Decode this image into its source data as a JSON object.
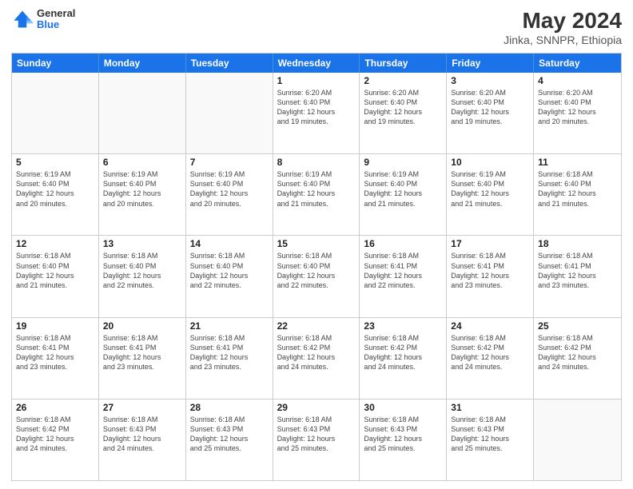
{
  "header": {
    "logo": {
      "line1": "General",
      "line2": "Blue"
    },
    "title": "May 2024",
    "location": "Jinka, SNNPR, Ethiopia"
  },
  "weekdays": [
    "Sunday",
    "Monday",
    "Tuesday",
    "Wednesday",
    "Thursday",
    "Friday",
    "Saturday"
  ],
  "rows": [
    [
      {
        "day": "",
        "info": "",
        "empty": true
      },
      {
        "day": "",
        "info": "",
        "empty": true
      },
      {
        "day": "",
        "info": "",
        "empty": true
      },
      {
        "day": "1",
        "info": "Sunrise: 6:20 AM\nSunset: 6:40 PM\nDaylight: 12 hours\nand 19 minutes.",
        "empty": false
      },
      {
        "day": "2",
        "info": "Sunrise: 6:20 AM\nSunset: 6:40 PM\nDaylight: 12 hours\nand 19 minutes.",
        "empty": false
      },
      {
        "day": "3",
        "info": "Sunrise: 6:20 AM\nSunset: 6:40 PM\nDaylight: 12 hours\nand 19 minutes.",
        "empty": false
      },
      {
        "day": "4",
        "info": "Sunrise: 6:20 AM\nSunset: 6:40 PM\nDaylight: 12 hours\nand 20 minutes.",
        "empty": false
      }
    ],
    [
      {
        "day": "5",
        "info": "Sunrise: 6:19 AM\nSunset: 6:40 PM\nDaylight: 12 hours\nand 20 minutes.",
        "empty": false
      },
      {
        "day": "6",
        "info": "Sunrise: 6:19 AM\nSunset: 6:40 PM\nDaylight: 12 hours\nand 20 minutes.",
        "empty": false
      },
      {
        "day": "7",
        "info": "Sunrise: 6:19 AM\nSunset: 6:40 PM\nDaylight: 12 hours\nand 20 minutes.",
        "empty": false
      },
      {
        "day": "8",
        "info": "Sunrise: 6:19 AM\nSunset: 6:40 PM\nDaylight: 12 hours\nand 21 minutes.",
        "empty": false
      },
      {
        "day": "9",
        "info": "Sunrise: 6:19 AM\nSunset: 6:40 PM\nDaylight: 12 hours\nand 21 minutes.",
        "empty": false
      },
      {
        "day": "10",
        "info": "Sunrise: 6:19 AM\nSunset: 6:40 PM\nDaylight: 12 hours\nand 21 minutes.",
        "empty": false
      },
      {
        "day": "11",
        "info": "Sunrise: 6:18 AM\nSunset: 6:40 PM\nDaylight: 12 hours\nand 21 minutes.",
        "empty": false
      }
    ],
    [
      {
        "day": "12",
        "info": "Sunrise: 6:18 AM\nSunset: 6:40 PM\nDaylight: 12 hours\nand 21 minutes.",
        "empty": false
      },
      {
        "day": "13",
        "info": "Sunrise: 6:18 AM\nSunset: 6:40 PM\nDaylight: 12 hours\nand 22 minutes.",
        "empty": false
      },
      {
        "day": "14",
        "info": "Sunrise: 6:18 AM\nSunset: 6:40 PM\nDaylight: 12 hours\nand 22 minutes.",
        "empty": false
      },
      {
        "day": "15",
        "info": "Sunrise: 6:18 AM\nSunset: 6:40 PM\nDaylight: 12 hours\nand 22 minutes.",
        "empty": false
      },
      {
        "day": "16",
        "info": "Sunrise: 6:18 AM\nSunset: 6:41 PM\nDaylight: 12 hours\nand 22 minutes.",
        "empty": false
      },
      {
        "day": "17",
        "info": "Sunrise: 6:18 AM\nSunset: 6:41 PM\nDaylight: 12 hours\nand 23 minutes.",
        "empty": false
      },
      {
        "day": "18",
        "info": "Sunrise: 6:18 AM\nSunset: 6:41 PM\nDaylight: 12 hours\nand 23 minutes.",
        "empty": false
      }
    ],
    [
      {
        "day": "19",
        "info": "Sunrise: 6:18 AM\nSunset: 6:41 PM\nDaylight: 12 hours\nand 23 minutes.",
        "empty": false
      },
      {
        "day": "20",
        "info": "Sunrise: 6:18 AM\nSunset: 6:41 PM\nDaylight: 12 hours\nand 23 minutes.",
        "empty": false
      },
      {
        "day": "21",
        "info": "Sunrise: 6:18 AM\nSunset: 6:41 PM\nDaylight: 12 hours\nand 23 minutes.",
        "empty": false
      },
      {
        "day": "22",
        "info": "Sunrise: 6:18 AM\nSunset: 6:42 PM\nDaylight: 12 hours\nand 24 minutes.",
        "empty": false
      },
      {
        "day": "23",
        "info": "Sunrise: 6:18 AM\nSunset: 6:42 PM\nDaylight: 12 hours\nand 24 minutes.",
        "empty": false
      },
      {
        "day": "24",
        "info": "Sunrise: 6:18 AM\nSunset: 6:42 PM\nDaylight: 12 hours\nand 24 minutes.",
        "empty": false
      },
      {
        "day": "25",
        "info": "Sunrise: 6:18 AM\nSunset: 6:42 PM\nDaylight: 12 hours\nand 24 minutes.",
        "empty": false
      }
    ],
    [
      {
        "day": "26",
        "info": "Sunrise: 6:18 AM\nSunset: 6:42 PM\nDaylight: 12 hours\nand 24 minutes.",
        "empty": false
      },
      {
        "day": "27",
        "info": "Sunrise: 6:18 AM\nSunset: 6:43 PM\nDaylight: 12 hours\nand 24 minutes.",
        "empty": false
      },
      {
        "day": "28",
        "info": "Sunrise: 6:18 AM\nSunset: 6:43 PM\nDaylight: 12 hours\nand 25 minutes.",
        "empty": false
      },
      {
        "day": "29",
        "info": "Sunrise: 6:18 AM\nSunset: 6:43 PM\nDaylight: 12 hours\nand 25 minutes.",
        "empty": false
      },
      {
        "day": "30",
        "info": "Sunrise: 6:18 AM\nSunset: 6:43 PM\nDaylight: 12 hours\nand 25 minutes.",
        "empty": false
      },
      {
        "day": "31",
        "info": "Sunrise: 6:18 AM\nSunset: 6:43 PM\nDaylight: 12 hours\nand 25 minutes.",
        "empty": false
      },
      {
        "day": "",
        "info": "",
        "empty": true
      }
    ]
  ]
}
